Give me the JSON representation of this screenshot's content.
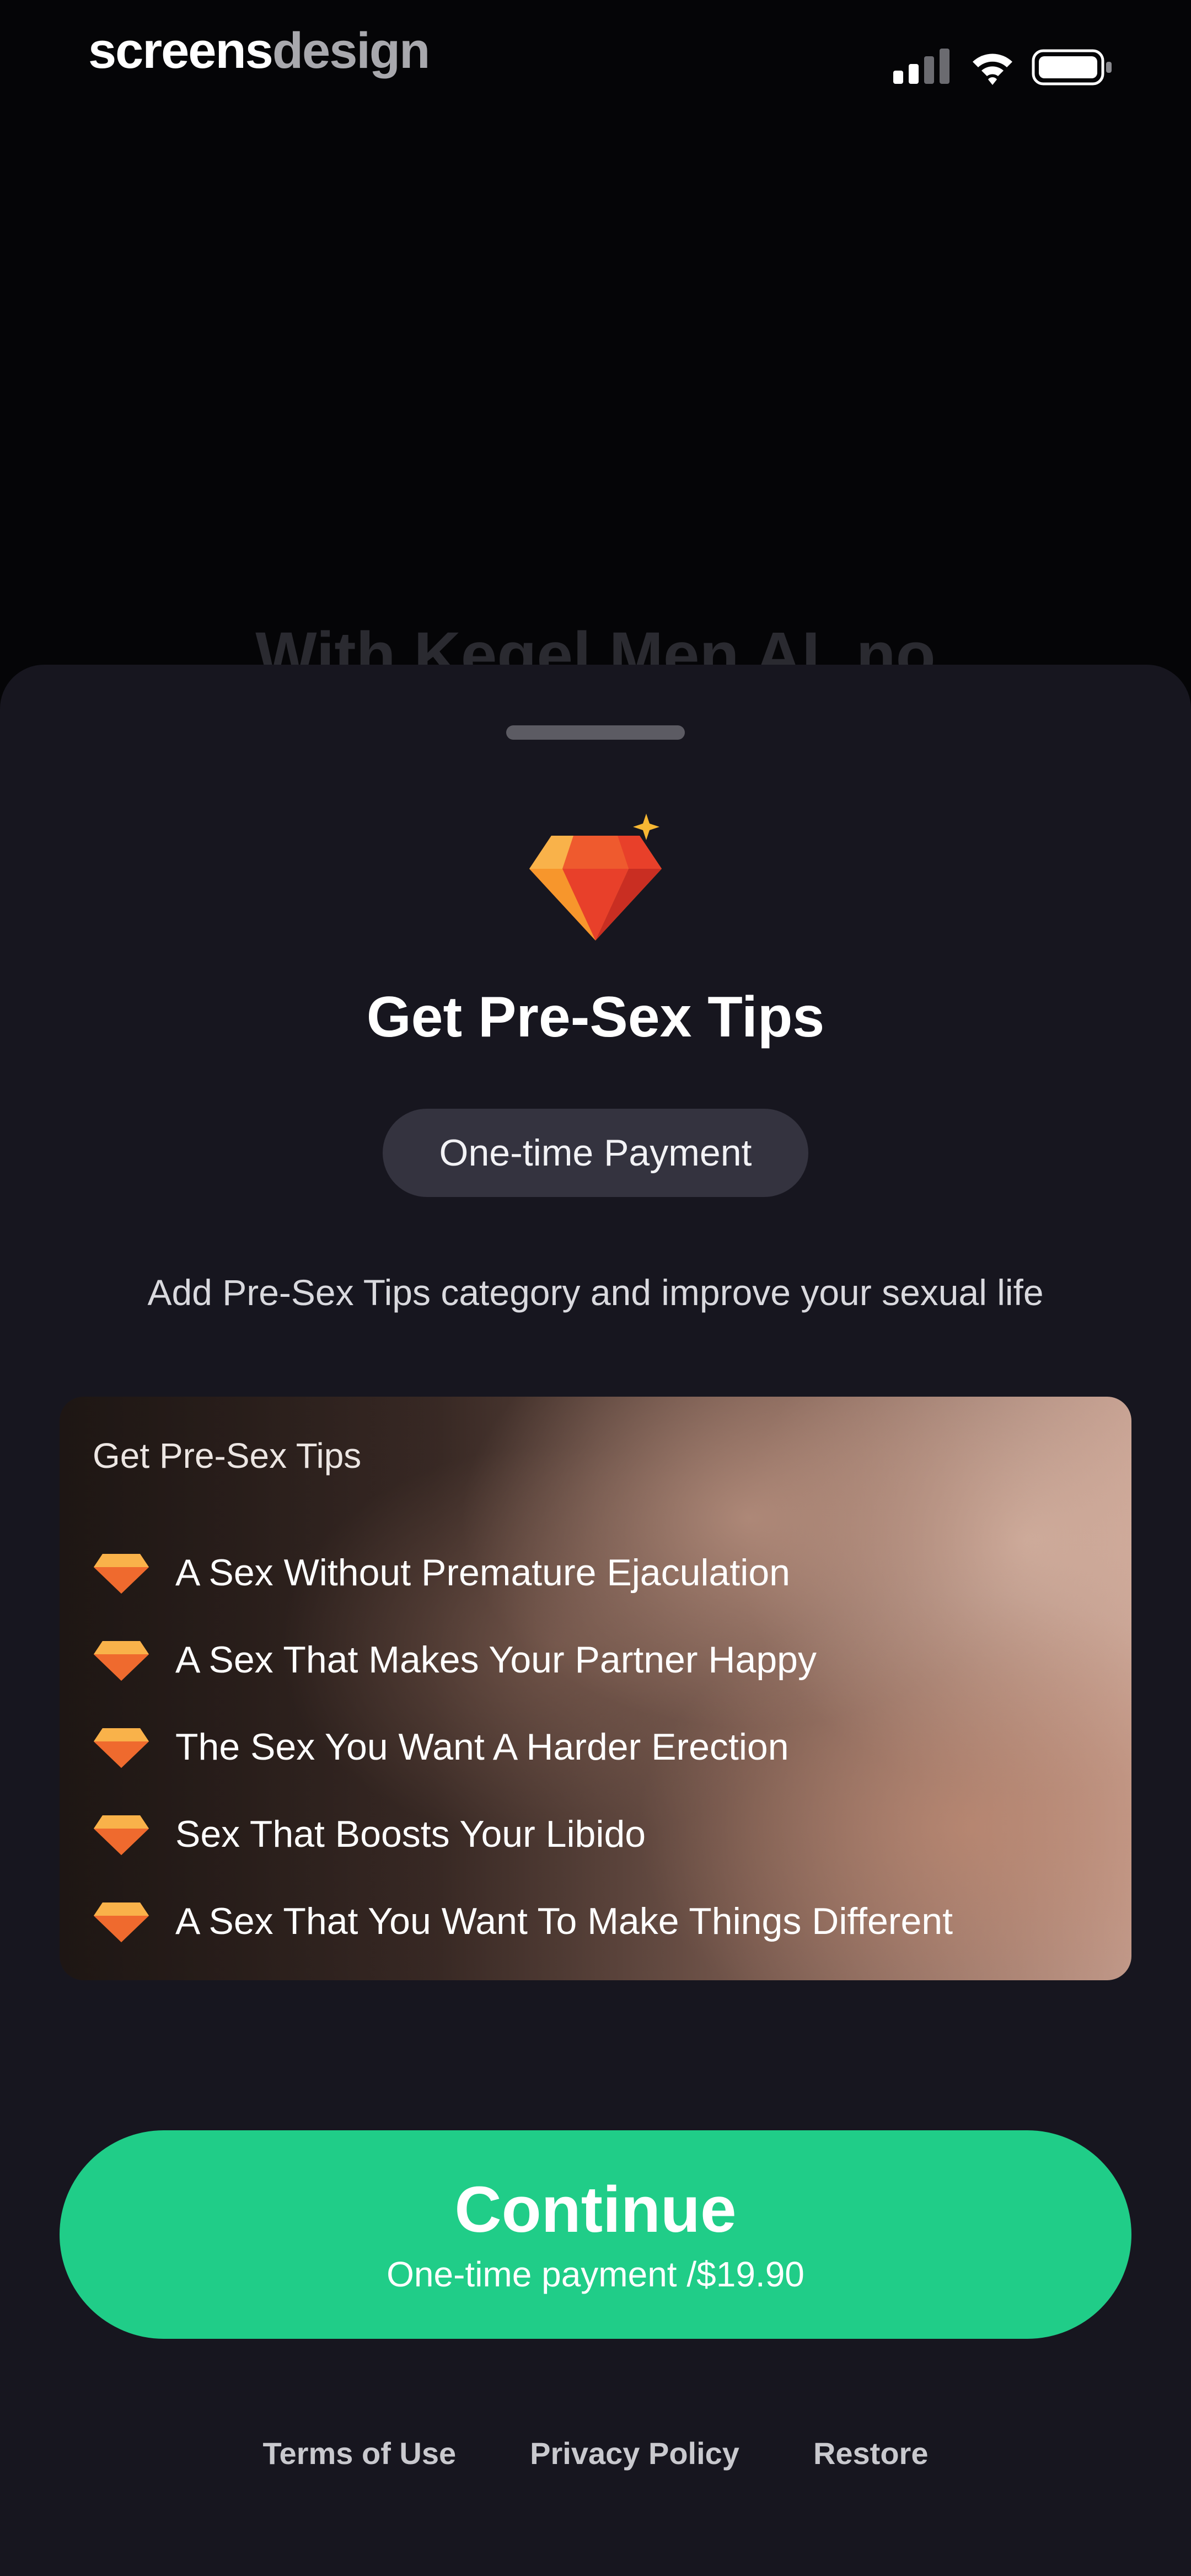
{
  "status_bar": {
    "brand_part1": "screens",
    "brand_part2": "design"
  },
  "background": {
    "headline": "With Kegel Men AI, no"
  },
  "sheet": {
    "title": "Get Pre-Sex Tips",
    "pill_label": "One-time Payment",
    "subtitle": "Add Pre-Sex Tips category and improve your sexual life",
    "card": {
      "heading": "Get Pre-Sex Tips",
      "items": [
        "A Sex Without Premature Ejaculation",
        "A Sex That Makes Your Partner Happy",
        "The Sex You Want A Harder Erection",
        "Sex That Boosts Your Libido",
        "A Sex That You Want To Make Things Different"
      ]
    },
    "continue_button": {
      "label": "Continue",
      "sublabel": "One-time payment /$19.90"
    },
    "footer": {
      "terms": "Terms of Use",
      "privacy": "Privacy Policy",
      "restore": "Restore"
    }
  },
  "colors": {
    "accent_green": "#20cd88",
    "sheet_bg": "#17161f",
    "gem_orange": "#f7962c",
    "gem_red": "#e8402a"
  },
  "icons": [
    "signal-icon",
    "wifi-icon",
    "battery-icon",
    "diamond-icon",
    "sparkle-icon"
  ]
}
